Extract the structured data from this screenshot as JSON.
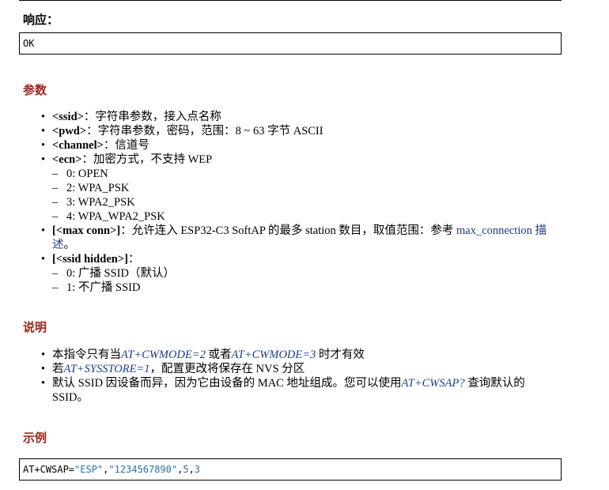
{
  "response": {
    "label": "响应：",
    "code": "OK"
  },
  "params": {
    "heading": "参数",
    "ssid": {
      "name": "<ssid>",
      "desc": "：字符串参数，接入点名称"
    },
    "pwd": {
      "name": "<pwd>",
      "desc": "：字符串参数，密码，范围：8 ~ 63 字节 ASCII"
    },
    "channel": {
      "name": "<channel>",
      "desc": "：信道号"
    },
    "ecn": {
      "name": "<ecn>",
      "desc": "：加密方式，不支持 WEP",
      "options": [
        "0: OPEN",
        "2: WPA_PSK",
        "3: WPA2_PSK",
        "4: WPA_WPA2_PSK"
      ]
    },
    "maxconn": {
      "name": "[<max conn>]",
      "desc": "：允许连入 ESP32-C3 SoftAP 的最多 station 数目，取值范围：参考 ",
      "link1": "max_connection 描",
      "link2": "述",
      "tail": "。"
    },
    "hidden": {
      "name": "[<ssid hidden>]",
      "desc": "：",
      "options": [
        "0: 广播 SSID（默认）",
        "1: 不广播 SSID"
      ]
    }
  },
  "notes": {
    "heading": "说明",
    "item1": {
      "t1": "本指令只有当",
      "l1": "AT+CWMODE=2",
      "t2": " 或者",
      "l2": "AT+CWMODE=3",
      "t3": " 时才有效"
    },
    "item2": {
      "t1": "若",
      "l1": "AT+SYSSTORE=1",
      "t2": "，配置更改将保存在 NVS 分区"
    },
    "item3": {
      "t1": "默认 SSID 因设备而异，因为它由设备的 MAC 地址组成。您可以使用",
      "l1": "AT+CWSAP?",
      "t2": " 查询默认的",
      "t3": "SSID。"
    }
  },
  "example": {
    "heading": "示例",
    "cmd": "AT+CWSAP=",
    "arg1": "\"ESP\"",
    "comma1": ",",
    "arg2": "\"1234567890\"",
    "comma2": ",",
    "arg3": "5",
    "comma3": ",",
    "arg4": "3"
  }
}
